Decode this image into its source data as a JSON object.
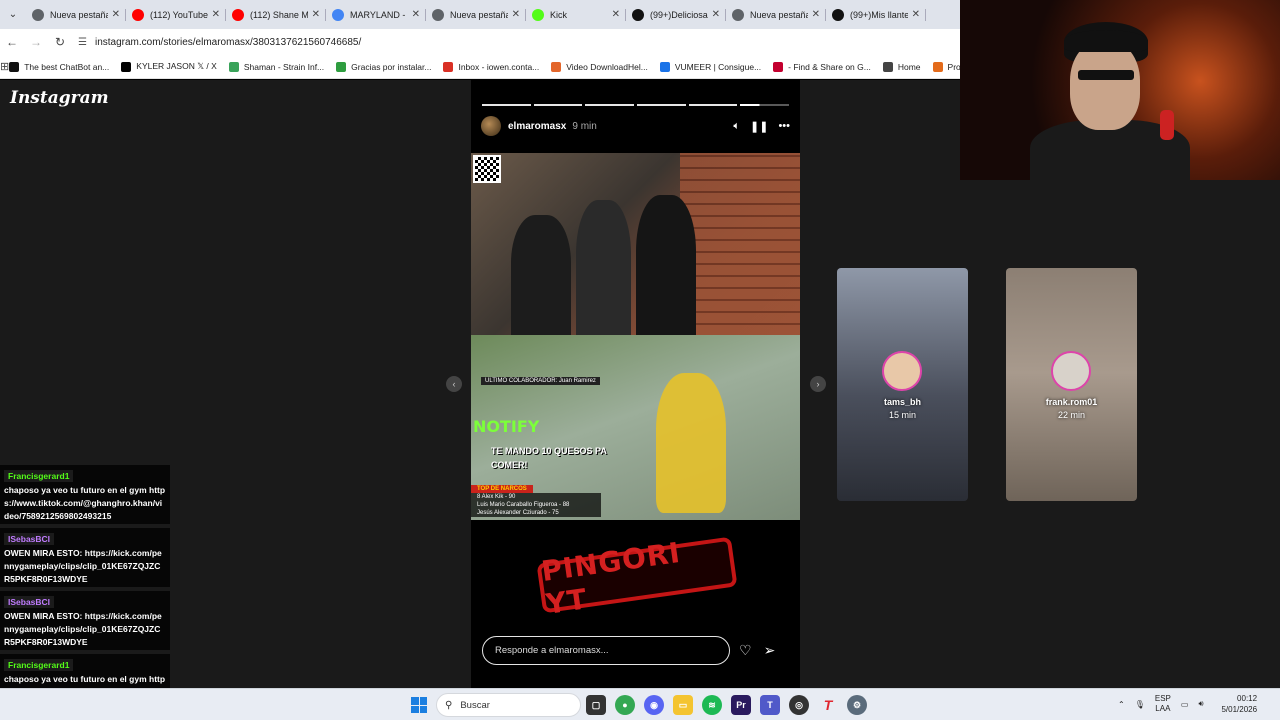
{
  "browser": {
    "tabs": [
      {
        "label": "Nueva pestaña",
        "color": "#5f6368"
      },
      {
        "label": "(112) YouTube",
        "color": "#ff0000"
      },
      {
        "label": "(112) Shane M",
        "color": "#ff0000"
      },
      {
        "label": "MARYLAND - M",
        "color": "#4285f4"
      },
      {
        "label": "Nueva pestaña",
        "color": "#5f6368"
      },
      {
        "label": "Kick",
        "color": "#53fc18"
      },
      {
        "label": "(99+)Deliciosa",
        "color": "#111111"
      },
      {
        "label": "Nueva pestaña",
        "color": "#5f6368"
      },
      {
        "label": "(99+)Mis llante",
        "color": "#111111"
      }
    ],
    "url": "instagram.com/stories/elmaromasx/3803137621560746685/",
    "bookmarks": [
      {
        "label": "The best ChatBot an...",
        "color": "#111111"
      },
      {
        "label": "KYLER JASON 𝕏 / X",
        "color": "#000000"
      },
      {
        "label": "Shaman - Strain Inf...",
        "color": "#3aa35a"
      },
      {
        "label": "Gracias por instalar...",
        "color": "#2e9d3f"
      },
      {
        "label": "Inbox - iowen.conta...",
        "color": "#d93025"
      },
      {
        "label": "Video DownloadHel...",
        "color": "#e3662b"
      },
      {
        "label": "VUMEER | Consigue...",
        "color": "#1a73e8"
      },
      {
        "label": "- Find & Share on G...",
        "color": "#c3002f"
      },
      {
        "label": "Home",
        "color": "#444444"
      },
      {
        "label": "Producto: Co",
        "color": "#e36b1b"
      }
    ]
  },
  "instagram": {
    "logo": "Instagram",
    "story": {
      "username": "elmaromasx",
      "time": "9 min",
      "game_hud": "ULTIMO COLABORADOR: Juan Ramirez",
      "game_brand": "NOTIFY",
      "caption": "TE MANDO 10 QUESOS PA COMER!",
      "leaderboard_title": "TOP DE NARCOS",
      "leaderboard": [
        "8 Alex Kik - 90",
        "Luis Mario Caraballo Figueroa - 88",
        "Jesús Alexander Cziurado - 75"
      ],
      "sticker": "PINGORI YT",
      "reply_placeholder": "Responde a elmaromasx..."
    },
    "previews": [
      {
        "name": "tams_bh",
        "time": "15 min"
      },
      {
        "name": "frank.rom01",
        "time": "22 min"
      }
    ]
  },
  "chat": [
    {
      "user": "Francisgerard1",
      "user_color": "#53fc18",
      "text": "chaposo ya veo tu futuro en el gym https://www.tiktok.com/@ghanghro.khan/video/7589212569802493215"
    },
    {
      "user": "ISebasBCI",
      "user_color": "#c07cff",
      "text": "OWEN MIRA ESTO: https://kick.com/pennygameplay/clips/clip_01KE67ZQJZCR5PKF8R0F13WDYE"
    },
    {
      "user": "ISebasBCI",
      "user_color": "#c07cff",
      "text": "OWEN MIRA ESTO: https://kick.com/pennygameplay/clips/clip_01KE67ZQJZCR5PKF8R0F13WDYE"
    },
    {
      "user": "Francisgerard1",
      "user_color": "#53fc18",
      "text": "chaposo ya veo tu futuro en el gym https://www.tiktok.com/@ghanghro.khan/video/7589212569802493215"
    }
  ],
  "taskbar": {
    "search_placeholder": "Buscar",
    "lang_top": "ESP",
    "lang_bottom": "LAA",
    "time": "00:12",
    "date": "5/01/2026"
  }
}
